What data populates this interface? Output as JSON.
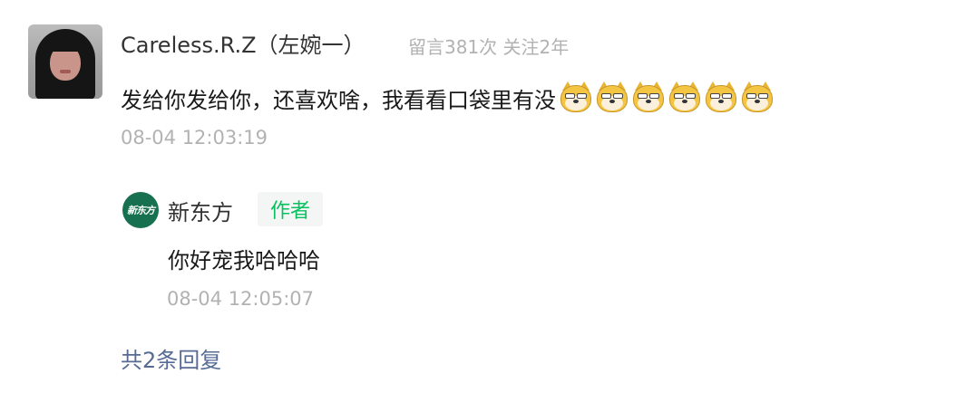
{
  "comment": {
    "author_name": "Careless.R.Z（左婉一）",
    "author_meta": "留言381次 关注2年",
    "text": "发给你发给你，还喜欢啥，我看看口袋里有没",
    "emojis": [
      "doge-emoji",
      "doge-emoji",
      "doge-emoji",
      "doge-emoji",
      "doge-emoji",
      "doge-emoji"
    ],
    "timestamp": "08-04 12:03:19"
  },
  "reply": {
    "author_name": "新东方",
    "avatar_text": "新东方",
    "badge": "作者",
    "text": "你好宠我哈哈哈",
    "timestamp": "08-04 12:05:07"
  },
  "reply_count_label": "共2条回复",
  "colors": {
    "badge_text": "#07c160",
    "link": "#576b95",
    "muted": "#b2b2b2",
    "brand_green": "#17704f"
  }
}
